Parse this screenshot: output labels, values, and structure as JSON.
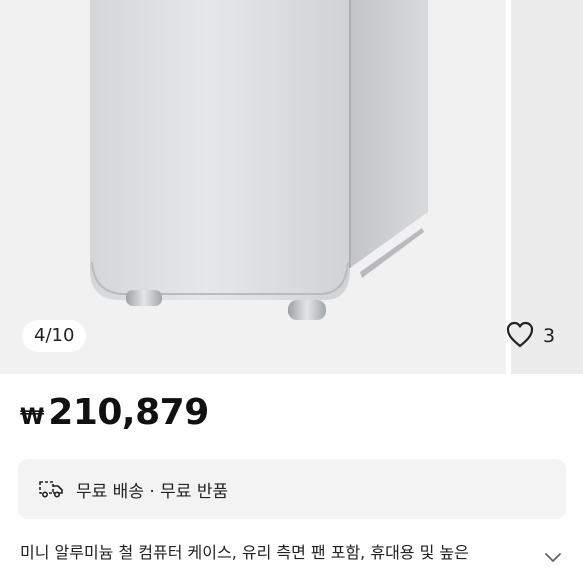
{
  "gallery": {
    "counter": "4/10",
    "like_count": "3"
  },
  "price": {
    "currency": "₩",
    "amount": "210,879"
  },
  "shipping": {
    "text": "무료 배송 · 무료 반품"
  },
  "product": {
    "title": "미니 알루미늄 철 컴퓨터 케이스, 유리 측면 팬 포함, 휴대용 및 높은"
  },
  "icons": [
    "truck-icon",
    "heart-icon",
    "chevron-down-icon"
  ]
}
